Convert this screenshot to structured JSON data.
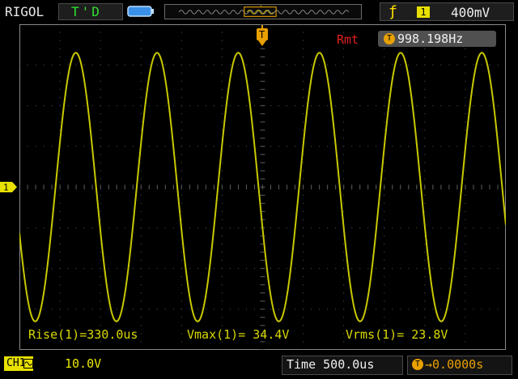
{
  "header": {
    "brand": "RIGOL",
    "status": "T'D",
    "trigger_edge_icon": "rising-edge-icon",
    "trigger_source": "1",
    "trigger_level": "400mV"
  },
  "display": {
    "channel_marker": "1",
    "trigger_marker": "T",
    "remote_label": "Rmt",
    "frequency_icon": "T",
    "frequency": "998.198Hz"
  },
  "measurements": {
    "rise": "Rise(1)=330.0us",
    "vmax": "Vmax(1)= 34.4V",
    "vrms": "Vrms(1)= 23.8V"
  },
  "footer": {
    "channel_label": "CH1",
    "channel_scale": "10.0V",
    "timebase": "Time 500.0us",
    "offset_icon": "T",
    "trigger_offset": "→0.0000s"
  },
  "colors": {
    "trace": "#c8c800",
    "grid": "#5a5a5a",
    "status_green": "#2fe02f",
    "remote_red": "#e02020",
    "trigger_orange": "#e8a000"
  },
  "waveform": {
    "cycles_on_screen": 5.99,
    "amplitude_divisions": 3.3,
    "phase_degrees": 200
  }
}
